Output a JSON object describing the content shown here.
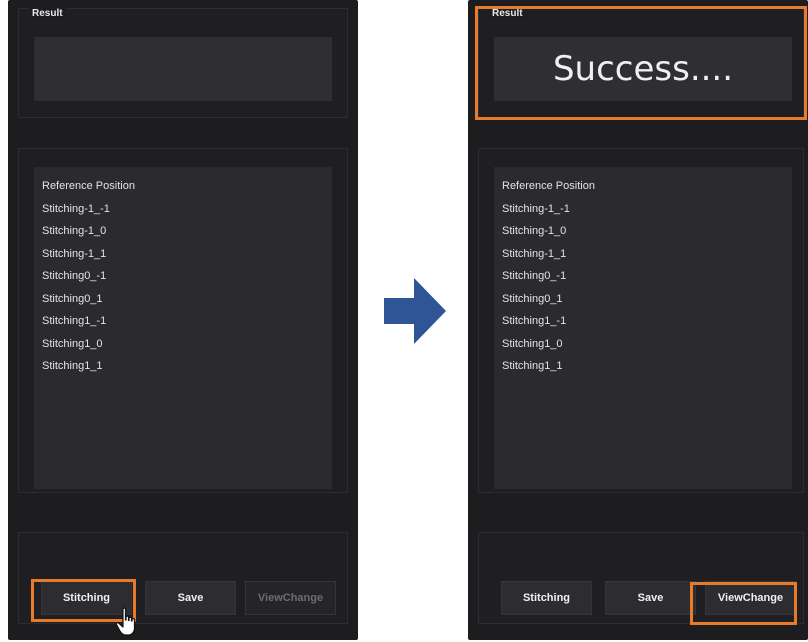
{
  "left_panel": {
    "result": {
      "label": "Result",
      "text": ""
    },
    "list_items": [
      "Reference Position",
      "Stitching-1_-1",
      "Stitching-1_0",
      "Stitching-1_1",
      "Stitching0_-1",
      "Stitching0_1",
      "Stitching1_-1",
      "Stitching1_0",
      "Stitching1_1"
    ],
    "buttons": {
      "stitching": "Stitching",
      "save": "Save",
      "view_change": "ViewChange"
    }
  },
  "right_panel": {
    "result": {
      "label": "Result",
      "text": "Success...."
    },
    "list_items": [
      "Reference Position",
      "Stitching-1_-1",
      "Stitching-1_0",
      "Stitching-1_1",
      "Stitching0_-1",
      "Stitching0_1",
      "Stitching1_-1",
      "Stitching1_0",
      "Stitching1_1"
    ],
    "buttons": {
      "stitching": "Stitching",
      "save": "Save",
      "view_change": "ViewChange"
    }
  },
  "colors": {
    "panel_background": "#1d1d20",
    "highlight": "#e87a2a",
    "arrow": "#2f5597"
  },
  "icons": {
    "transition": "right-arrow-icon",
    "pointer": "hand-cursor-icon"
  }
}
